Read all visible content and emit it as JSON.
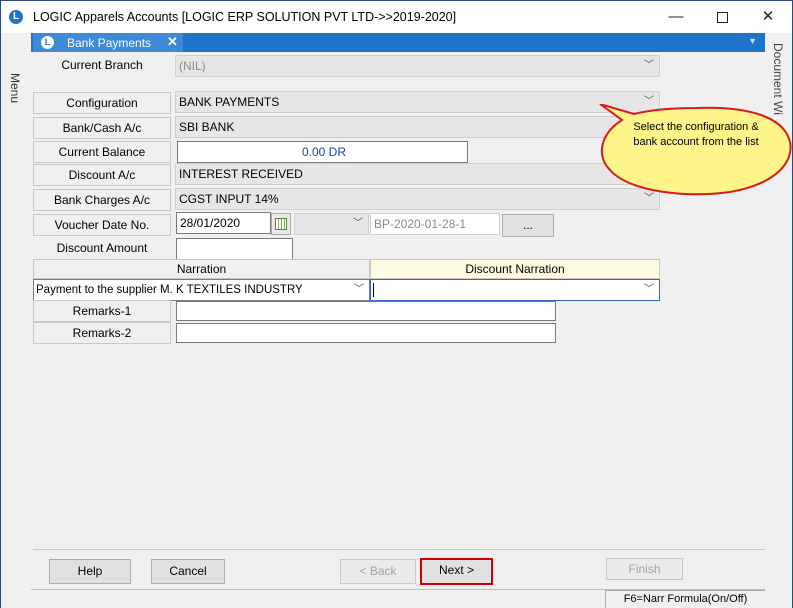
{
  "window": {
    "title": "LOGIC Apparels Accounts  [LOGIC ERP SOLUTION PVT LTD->>2019-2020]",
    "minimize_glyph": "—",
    "close_glyph": "✕"
  },
  "side": {
    "menu_label": "Menu",
    "document_window_label": "Document Wi"
  },
  "tab": {
    "label": "Bank Payments",
    "close_glyph": "✕"
  },
  "form": {
    "current_branch": {
      "label": "Current Branch",
      "value": "(NIL)"
    },
    "configuration": {
      "label": "Configuration",
      "value": "BANK PAYMENTS"
    },
    "bank_cash": {
      "label": "Bank/Cash A/c",
      "value": "SBI BANK"
    },
    "current_balance": {
      "label": "Current Balance",
      "value": "0.00 DR"
    },
    "discount_ac": {
      "label": "Discount A/c",
      "value": "INTEREST RECEIVED"
    },
    "bank_charges": {
      "label": "Bank Charges A/c",
      "value": "CGST INPUT 14%"
    },
    "voucher_date": {
      "label": "Voucher Date  No.",
      "date": "28/01/2020",
      "number": "BP-2020-01-28-1",
      "browse": "..."
    },
    "discount_amount": {
      "label": "Discount Amount",
      "value": ""
    },
    "narration": {
      "header": "Narration",
      "value": "Payment to the supplier M. K TEXTILES INDUSTRY"
    },
    "discount_narration": {
      "header": "Discount Narration",
      "value": ""
    },
    "remarks1": {
      "label": "Remarks-1",
      "value": ""
    },
    "remarks2": {
      "label": "Remarks-2",
      "value": ""
    }
  },
  "callout": {
    "text": "Select the configuration & bank account from the list"
  },
  "buttons": {
    "help": "Help",
    "cancel": "Cancel",
    "back": "< Back",
    "next": "Next >",
    "finish": "Finish"
  },
  "status": {
    "hint": "F6=Narr Formula(On/Off)"
  },
  "colors": {
    "tab_blue": "#1e74c8",
    "callout_fill": "#fdf58a",
    "callout_border": "#d81b1b",
    "focus_border": "#d00000",
    "discount_header_bg": "#fffbe0"
  }
}
